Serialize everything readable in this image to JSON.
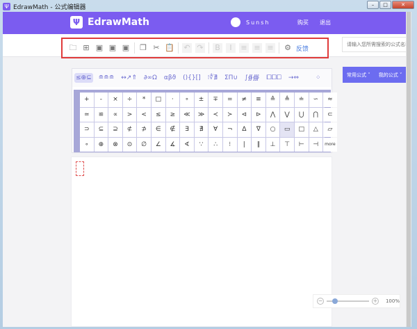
{
  "window": {
    "title": "EdrawMath - 公式编辑器",
    "min": "–",
    "max": "□",
    "close": "✕"
  },
  "header": {
    "logo_mark": "Ψ",
    "brand": "EdrawMath",
    "username": "Sunsh",
    "buy": "购买",
    "logout": "退出"
  },
  "toolbar": {
    "items": [
      {
        "name": "open-icon",
        "glyph": "🗀",
        "disabled": false
      },
      {
        "name": "new-icon",
        "glyph": "⊞",
        "disabled": false
      },
      {
        "name": "export-pdf-icon",
        "glyph": "▣",
        "disabled": false
      },
      {
        "name": "export-image-icon",
        "glyph": "▣",
        "disabled": false
      },
      {
        "name": "export-latex-icon",
        "glyph": "▣",
        "disabled": false
      },
      {
        "name": "copy-icon",
        "glyph": "❐",
        "disabled": false
      },
      {
        "name": "cut-icon",
        "glyph": "✂",
        "disabled": false
      },
      {
        "name": "paste-icon",
        "glyph": "📋",
        "disabled": false
      },
      {
        "name": "undo-icon",
        "glyph": "↶",
        "disabled": true
      },
      {
        "name": "redo-icon",
        "glyph": "↷",
        "disabled": true
      },
      {
        "name": "bold-icon",
        "glyph": "B",
        "disabled": true
      },
      {
        "name": "italic-icon",
        "glyph": "I",
        "disabled": true
      },
      {
        "name": "align-left-icon",
        "glyph": "≡",
        "disabled": true
      },
      {
        "name": "align-center-icon",
        "glyph": "≡",
        "disabled": true
      },
      {
        "name": "align-right-icon",
        "glyph": "≡",
        "disabled": true
      },
      {
        "name": "settings-icon",
        "glyph": "⚙",
        "disabled": false
      }
    ],
    "feedback": "反馈"
  },
  "search": {
    "placeholder": "请输入您所需搜索的公式名称"
  },
  "categories": [
    "≤⊕⊆",
    "≘≘≘",
    "↔↗⇑",
    "∂∞Ω",
    "αβϑ",
    "(){}[]",
    "⁝∜∄",
    "ΣΠ∪",
    "∫∯∰",
    "⧠⧠⧠",
    "→⇔",
    "⁘"
  ],
  "active_category": 0,
  "symbols": [
    "+",
    "-",
    "×",
    "÷",
    "*",
    "□",
    "·",
    "∘",
    "±",
    "∓",
    "=",
    "≠",
    "≡",
    "≙",
    "≜",
    "≐",
    "∽",
    "≈",
    "≃",
    "≌",
    "∝",
    ">",
    "<",
    "≤",
    "≥",
    "≪",
    "≫",
    "≺",
    "≻",
    "⊲",
    "⊳",
    "⋀",
    "⋁",
    "⋃",
    "⋂",
    "⊂",
    "⊃",
    "⊆",
    "⊇",
    "⊄",
    "⊅",
    "∈",
    "∉",
    "∃",
    "∄",
    "∀",
    "¬",
    "∆",
    "∇",
    "○",
    "▭",
    "□",
    "△",
    "▱",
    "∘",
    "⊕",
    "⊗",
    "⊙",
    "∅",
    "∠",
    "∡",
    "∢",
    "∵",
    "∴",
    "⁝",
    "|",
    "∥",
    "⊥",
    "⊤",
    "⊢",
    "⊣",
    "more"
  ],
  "selected_symbol": 50,
  "right_panel": {
    "tabs": [
      "常用公式 ˅",
      "我的公式 ˅"
    ]
  },
  "zoom": {
    "minus": "−",
    "plus": "+",
    "value_percent": 100,
    "label": "100%",
    "slider_fraction": 0.2
  }
}
